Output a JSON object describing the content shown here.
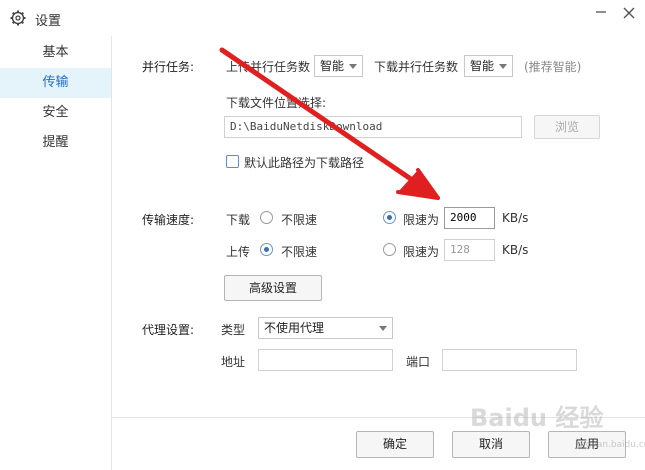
{
  "window": {
    "title": "设置"
  },
  "sidebar": {
    "items": [
      {
        "label": "基本",
        "active": false
      },
      {
        "label": "传输",
        "active": true
      },
      {
        "label": "安全",
        "active": false
      },
      {
        "label": "提醒",
        "active": false
      }
    ]
  },
  "parallel": {
    "section_label": "并行任务:",
    "upload_label": "上传并行任务数",
    "upload_value": "智能",
    "download_label": "下载并行任务数",
    "download_value": "智能",
    "hint": "(推荐智能)"
  },
  "location": {
    "label": "下载文件位置选择:",
    "path": "D:\\BaiduNetdiskDownload",
    "browse_label": "浏览",
    "default_checkbox_label": "默认此路径为下载路径",
    "default_checked": false
  },
  "speed": {
    "section_label": "传输速度:",
    "download": {
      "label": "下载",
      "unlimited_label": "不限速",
      "limit_label": "限速为",
      "value": "2000",
      "unit": "KB/s",
      "mode": "limit"
    },
    "upload": {
      "label": "上传",
      "unlimited_label": "不限速",
      "limit_label": "限速为",
      "value": "128",
      "unit": "KB/s",
      "mode": "unlimited"
    },
    "advanced_label": "高级设置"
  },
  "proxy": {
    "section_label": "代理设置:",
    "type_label": "类型",
    "type_value": "不使用代理",
    "address_label": "地址",
    "address_value": "",
    "port_label": "端口",
    "port_value": ""
  },
  "footer": {
    "ok_label": "确定",
    "cancel_label": "取消",
    "apply_label": "应用"
  },
  "watermark": {
    "text": "Baidu 经验",
    "sub": "jingyan.baidu.com"
  },
  "colors": {
    "accent": "#1f6fc5",
    "sidebar_active_bg": "#e5f3fb",
    "annotation_arrow": "#e02020"
  }
}
